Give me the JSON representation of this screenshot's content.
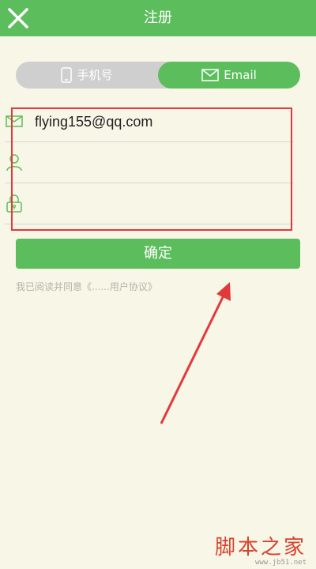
{
  "header": {
    "title": "注册",
    "close_icon": "close-icon"
  },
  "toggle": {
    "phone_label": "手机号",
    "phone_icon": "mobile-phone-icon",
    "email_label": "Email",
    "email_icon": "envelope-icon",
    "selected": "Email"
  },
  "form": {
    "email_value": "flying155@qq.com",
    "email_icon": "envelope-icon",
    "username_value": "",
    "username_icon": "person-icon",
    "password_value": "",
    "password_icon": "lock-icon"
  },
  "confirm_label": "确定",
  "agreement_text": "我已阅读并同意《......用户协议》",
  "watermark": {
    "main": "脚本之家",
    "url": "www.jb51.net"
  },
  "colors": {
    "accent": "#5cbd5c",
    "background": "#f7f6e7",
    "highlight": "#e23a3a"
  }
}
